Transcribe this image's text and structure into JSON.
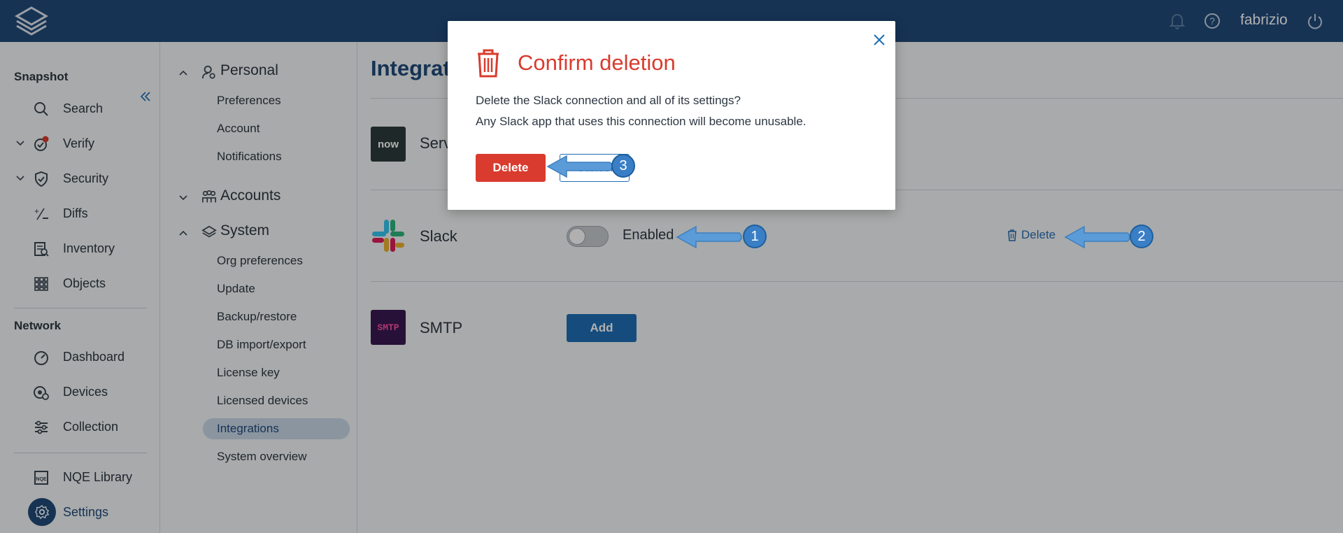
{
  "topbar": {
    "username": "fabrizio",
    "icons": [
      "logo-icon",
      "bell-icon",
      "help-icon",
      "power-icon"
    ]
  },
  "leftnav": {
    "snapshot_title": "Snapshot",
    "snapshot_items": [
      {
        "label": "Search",
        "icon": "search-icon"
      },
      {
        "label": "Verify",
        "icon": "verify-icon"
      },
      {
        "label": "Security",
        "icon": "shield-icon"
      },
      {
        "label": "Diffs",
        "icon": "diffs-icon"
      },
      {
        "label": "Inventory",
        "icon": "inventory-icon"
      },
      {
        "label": "Objects",
        "icon": "objects-icon"
      }
    ],
    "network_title": "Network",
    "network_items": [
      {
        "label": "Dashboard",
        "icon": "dashboard-icon"
      },
      {
        "label": "Devices",
        "icon": "devices-icon"
      },
      {
        "label": "Collection",
        "icon": "collection-icon"
      }
    ],
    "bottom_items": [
      {
        "label": "NQE Library",
        "icon": "nqe-icon"
      },
      {
        "label": "Settings",
        "icon": "gear-icon"
      }
    ]
  },
  "subnav": {
    "personal": "Personal",
    "personal_items": [
      "Preferences",
      "Account",
      "Notifications"
    ],
    "accounts": "Accounts",
    "system": "System",
    "system_items": [
      "Org preferences",
      "Update",
      "Backup/restore",
      "DB import/export",
      "License key",
      "Licensed devices",
      "Integrations",
      "System overview"
    ]
  },
  "main": {
    "title": "Integrations",
    "title_visible": "Integrati",
    "integrations": [
      {
        "name": "Serv",
        "logo": "now"
      },
      {
        "name": "Slack",
        "status": "Enabled",
        "action": "Delete"
      },
      {
        "name": "SMTP",
        "action": "Add",
        "logo": "SMTP"
      }
    ]
  },
  "modal": {
    "title": "Confirm deletion",
    "line1": "Delete the Slack connection and all of its settings?",
    "line2": "Any Slack app that uses this connection will become unusable.",
    "delete_label": "Delete",
    "cancel_label": "Cancel"
  },
  "annotations": [
    "1",
    "2",
    "3"
  ],
  "colors": {
    "topbar": "#204a7a",
    "accent": "#1f6fb5",
    "danger": "#d93b2e",
    "annotation": "#5a9bd8"
  }
}
